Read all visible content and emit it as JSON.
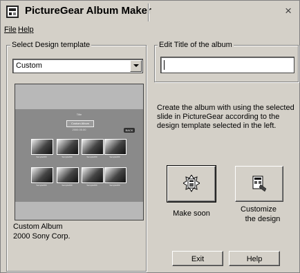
{
  "window": {
    "title": "PictureGear Album Maker",
    "close_label": "×"
  },
  "menu": {
    "file": "File",
    "help": "Help"
  },
  "template_group": {
    "legend": "Select Design template",
    "selected": "Custom",
    "preview": {
      "top_caption": "Title",
      "album_label": "Custom Album",
      "date_caption": "2000.00.00",
      "tag": "BACK",
      "thumb_label": "Sample000"
    },
    "credit_line1": "Custom Album",
    "credit_line2": "2000 Sony Corp."
  },
  "title_group": {
    "legend": "Edit Title of the album",
    "value": ""
  },
  "description": "Create the album with using the selected slide in PictureGear according to the design template selected in the left.",
  "actions": {
    "make_soon": "Make soon",
    "customize_line1": "Customize",
    "customize_line2": "the design"
  },
  "footer": {
    "exit": "Exit",
    "help": "Help"
  }
}
